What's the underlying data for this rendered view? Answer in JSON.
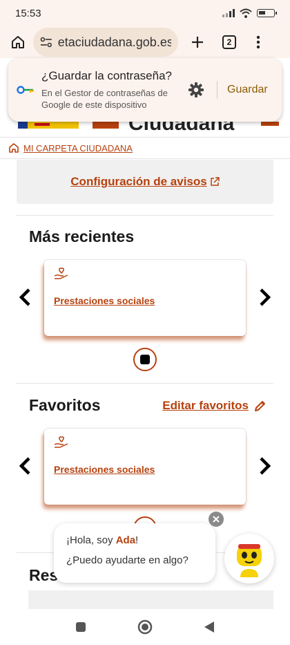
{
  "status_bar": {
    "time": "15:53"
  },
  "browser": {
    "url": "etaciudadana.gob.es",
    "tab_count": "2"
  },
  "password_prompt": {
    "title": "¿Guardar la contraseña?",
    "subtitle": "En el Gestor de contraseñas de Google de este dispositivo",
    "save_label": "Guardar"
  },
  "header": {
    "site_name_partial": "Ciudadana"
  },
  "breadcrumb": {
    "label": "MI CARPETA CIUDADANA"
  },
  "notices": {
    "config_link": "Configuración de avisos"
  },
  "recent": {
    "title": "Más recientes",
    "card_label": "Prestaciones sociales"
  },
  "favorites": {
    "title": "Favoritos",
    "edit_label": "Editar favoritos",
    "card_label": "Prestaciones sociales"
  },
  "next_section": {
    "title_partial": "Res"
  },
  "chat": {
    "greeting_prefix": "¡Hola, soy ",
    "assistant_name": "Ada",
    "greeting_suffix": "!",
    "question": "¿Puedo ayudarte en algo?"
  },
  "colors": {
    "accent": "#b7410e",
    "browser_bg": "#fdf3ee",
    "card_bg": "#f0f0f0"
  }
}
